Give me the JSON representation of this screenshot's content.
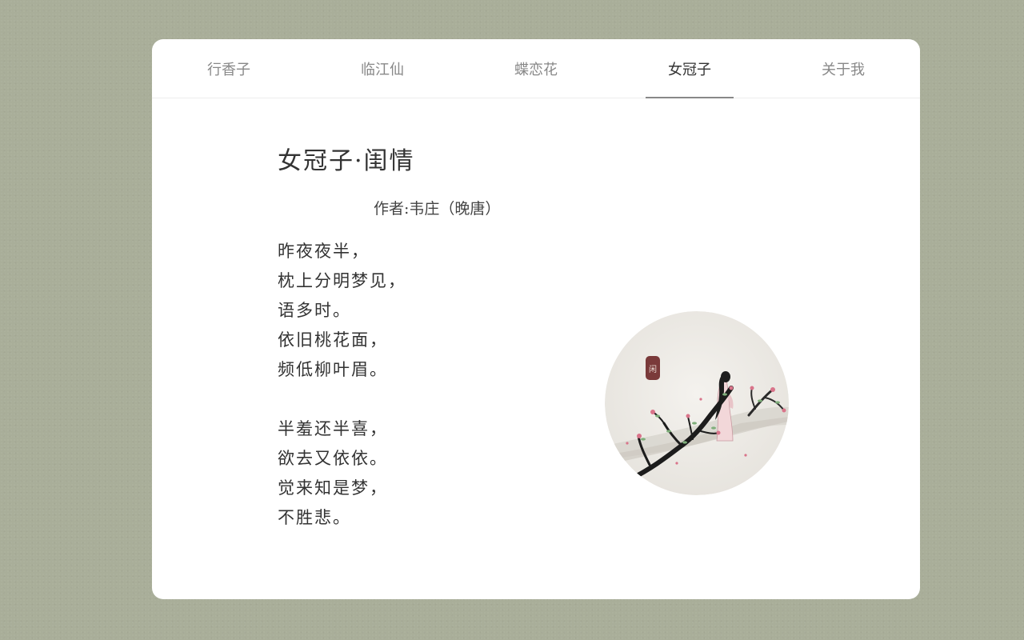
{
  "nav": {
    "tabs": [
      {
        "label": "行香子",
        "active": false
      },
      {
        "label": "临江仙",
        "active": false
      },
      {
        "label": "蝶恋花",
        "active": false
      },
      {
        "label": "女冠子",
        "active": true
      },
      {
        "label": "关于我",
        "active": false
      }
    ]
  },
  "poem": {
    "title": "女冠子·闺情",
    "author": "作者:韦庄（晚唐）",
    "stanzas": [
      [
        "昨夜夜半，",
        "枕上分明梦见，",
        "语多时。",
        "依旧桃花面，",
        "频低柳叶眉。"
      ],
      [
        "半羞还半喜，",
        "欲去又依依。",
        "觉来知是梦，",
        "不胜悲。"
      ]
    ]
  },
  "illustration": {
    "icon": "ink-painting-woman-plum-blossom",
    "seal_text": "闲"
  },
  "colors": {
    "background": "#a9ae99",
    "card": "#ffffff",
    "text": "#333333",
    "tab_inactive": "#888888",
    "blossom": "#d9748a",
    "seal": "#7a3a3a"
  }
}
